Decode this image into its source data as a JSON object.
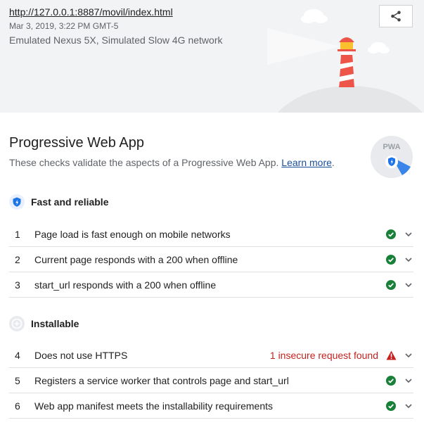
{
  "header": {
    "url": "http://127.0.0.1:8887/movil/index.html",
    "date": "Mar 3, 2019, 3:22 PM GMT-5",
    "environment": "Emulated Nexus 5X, Simulated Slow 4G network"
  },
  "category": {
    "title": "Progressive Web App",
    "description": "These checks validate the aspects of a Progressive Web App.",
    "learn_more": "Learn more",
    "description_end": ".",
    "badge_text": "PWA"
  },
  "groups": [
    {
      "label": "Fast and reliable",
      "audits": [
        {
          "num": "1",
          "title": "Page load is fast enough on mobile networks",
          "display": "",
          "status": "pass"
        },
        {
          "num": "2",
          "title": "Current page responds with a 200 when offline",
          "display": "",
          "status": "pass"
        },
        {
          "num": "3",
          "title": "start_url responds with a 200 when offline",
          "display": "",
          "status": "pass"
        }
      ]
    },
    {
      "label": "Installable",
      "audits": [
        {
          "num": "4",
          "title": "Does not use HTTPS",
          "display": "1 insecure request found",
          "status": "fail"
        },
        {
          "num": "5",
          "title": "Registers a service worker that controls page and start_url",
          "display": "",
          "status": "pass"
        },
        {
          "num": "6",
          "title": "Web app manifest meets the installability requirements",
          "display": "",
          "status": "pass"
        }
      ]
    }
  ],
  "colors": {
    "pass": "#188038",
    "fail": "#c5221f",
    "link": "#1a4f9c",
    "badge_blue": "#1a73e8"
  }
}
